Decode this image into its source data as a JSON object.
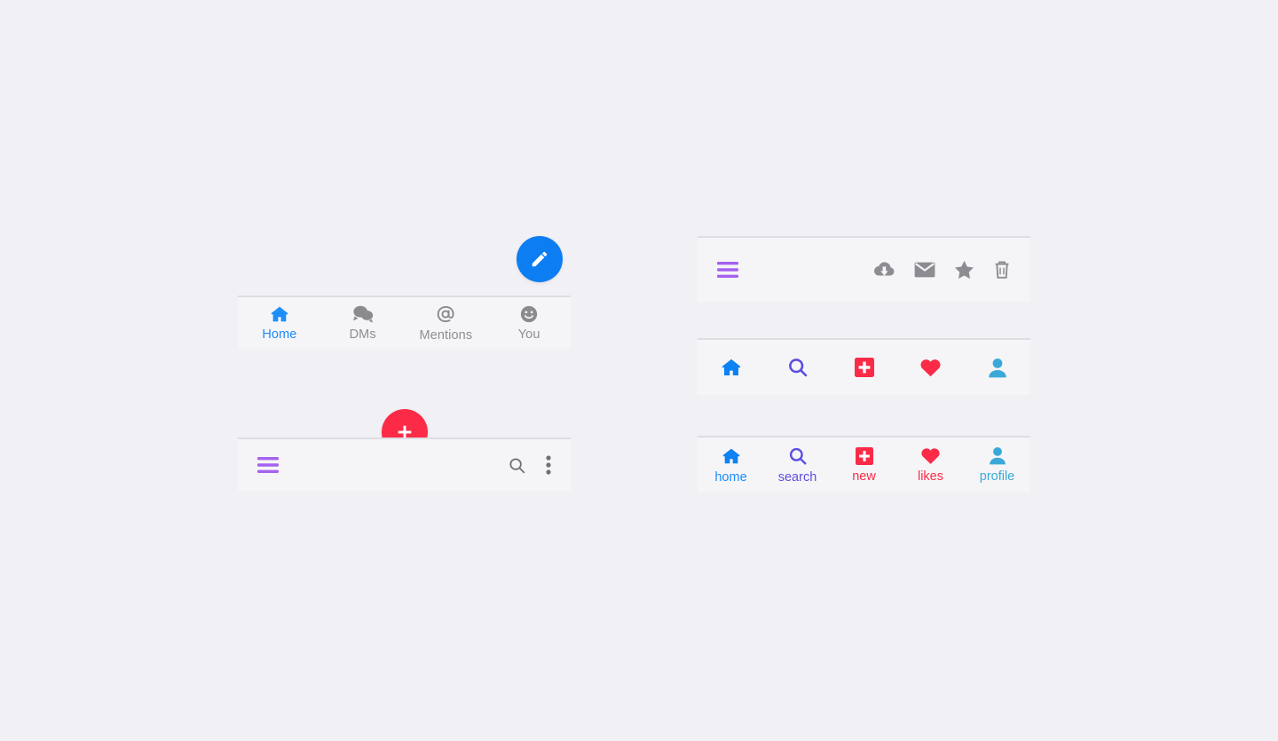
{
  "page": {
    "background_color": "#f1f0f5",
    "panel_background_color": "#f5f5f7",
    "panel_border_color": "#dedde4"
  },
  "left_column": {
    "compose_fab": {
      "icon": "pencil-icon",
      "label": "Compose",
      "background_color": "#0d7df2",
      "icon_color": "#ffffff"
    },
    "tab_bar": {
      "tabs": [
        {
          "label": "Home",
          "icon": "home-icon",
          "active": true,
          "color": "#1b8cf8",
          "icon_color": "#1b8cf8"
        },
        {
          "label": "DMs",
          "icon": "chat-bubbles-icon",
          "active": false,
          "color": "#8e8e93",
          "icon_color": "#8a8a8f"
        },
        {
          "label": "Mentions",
          "icon": "at-sign-icon",
          "active": false,
          "color": "#8e8e93",
          "icon_color": "#8a8a8f"
        },
        {
          "label": "You",
          "icon": "smiley-face-icon",
          "active": false,
          "color": "#8e8e93",
          "icon_color": "#8a8a8f"
        }
      ]
    },
    "new_fab": {
      "icon": "plus-icon",
      "label": "New",
      "background_color": "#fb2b48",
      "icon_color": "#ffffff"
    },
    "action_bar": {
      "menu": {
        "icon": "hamburger-menu-icon",
        "label": "Menu",
        "color": "#a561f0"
      },
      "actions": [
        {
          "icon": "search-icon",
          "label": "Search",
          "color": "#6f6f76"
        },
        {
          "icon": "kebab-menu-icon",
          "label": "More options",
          "color": "#6f6f76"
        }
      ]
    }
  },
  "right_column": {
    "toolbar": {
      "menu": {
        "icon": "hamburger-menu-icon",
        "label": "Menu",
        "color": "#a561f0"
      },
      "actions": [
        {
          "icon": "cloud-download-icon",
          "label": "Download",
          "color": "#8c8c92"
        },
        {
          "icon": "envelope-icon",
          "label": "Mail",
          "color": "#8c8c92"
        },
        {
          "icon": "star-icon",
          "label": "Favorite",
          "color": "#8c8c92"
        },
        {
          "icon": "trash-icon",
          "label": "Delete",
          "color": "#8c8c92"
        }
      ]
    },
    "icon_nav": {
      "items": [
        {
          "icon": "home-icon",
          "label": "Home",
          "color": "#0d82f2"
        },
        {
          "icon": "search-icon",
          "label": "Search",
          "color": "#5b4ee0"
        },
        {
          "icon": "plus-square-icon",
          "label": "New",
          "color": "#fb2b48"
        },
        {
          "icon": "heart-icon",
          "label": "Likes",
          "color": "#fb2b48"
        },
        {
          "icon": "person-icon",
          "label": "Profile",
          "color": "#3aa9d8"
        }
      ]
    },
    "labeled_nav": {
      "items": [
        {
          "icon": "home-icon",
          "label": "home",
          "color": "#1b8cf8",
          "icon_color": "#0d82f2"
        },
        {
          "icon": "search-icon",
          "label": "search",
          "color": "#5b4ee0",
          "icon_color": "#5b4ee0"
        },
        {
          "icon": "plus-square-icon",
          "label": "new",
          "color": "#fb2b48",
          "icon_color": "#fb2b48"
        },
        {
          "icon": "heart-icon",
          "label": "likes",
          "color": "#fb2b48",
          "icon_color": "#fb2b48"
        },
        {
          "icon": "person-icon",
          "label": "profile",
          "color": "#3aa9d8",
          "icon_color": "#3aa9d8"
        }
      ]
    }
  }
}
